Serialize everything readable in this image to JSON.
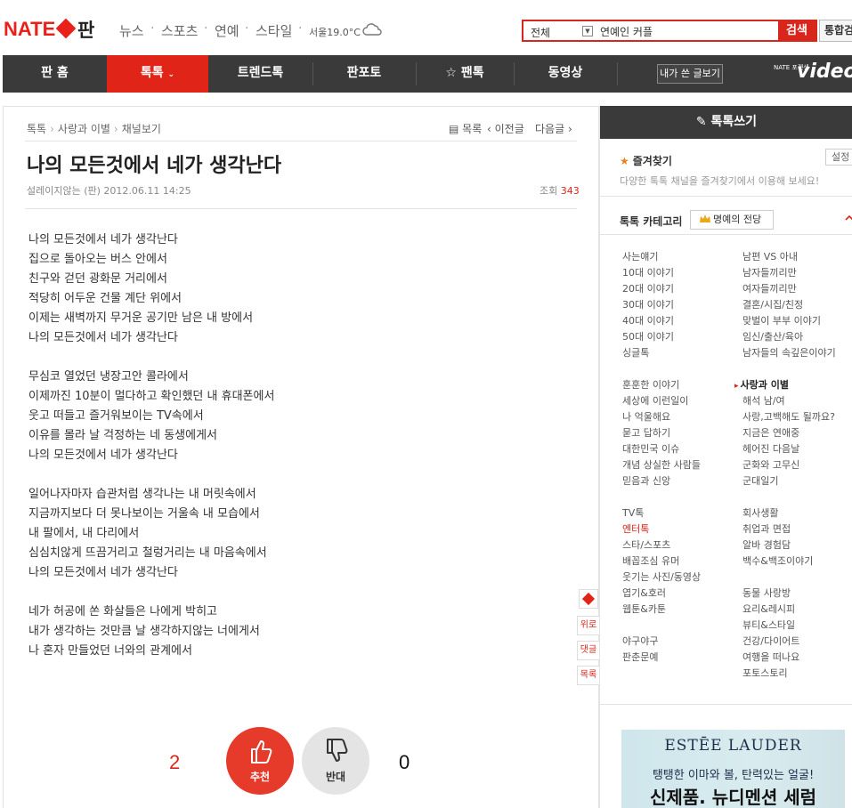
{
  "header": {
    "logo_text": "NATE",
    "logo_pan": "판",
    "links": [
      "뉴스",
      "스포츠",
      "연예",
      "스타일"
    ],
    "weather": "서울19.0°C",
    "search": {
      "scope": "전체",
      "value": "연예인 커플",
      "button": "검색",
      "total_button": "통합검색"
    }
  },
  "nav": {
    "items": [
      "판 홈",
      "톡톡",
      "트렌드톡",
      "판포토",
      "팬톡",
      "동영상"
    ],
    "active_index": 1,
    "my_posts": "내가 쓴 글보기",
    "video_small": "NATE 포켓생",
    "video_big": "video"
  },
  "article": {
    "breadcrumb": [
      "톡톡",
      "사랑과 이별",
      "채널보기"
    ],
    "post_nav": {
      "list": "목록",
      "prev": "이전글",
      "next": "다음글"
    },
    "title": "나의 모든것에서 네가 생각난다",
    "meta": "설레이지않는 (판) 2012.06.11 14:25",
    "views_label": "조회",
    "views": "343",
    "body": [
      "나의 모든것에서 네가 생각난다",
      "집으로 돌아오는 버스 안에서",
      "친구와 걷던 광화문 거리에서",
      "적당히 어두운 건물 계단 위에서",
      "이제는 새벽까지 무거운 공기만 남은 내 방에서",
      "나의 모든것에서 네가 생각난다",
      "",
      "무심코 열었던 냉장고안 콜라에서",
      "이제까진 10분이 멀다하고 확인했던 내 휴대폰에서",
      "웃고 떠들고 즐거워보이는 TV속에서",
      "이유를 몰라 날 걱정하는 네 동생에게서",
      "나의 모든것에서 네가 생각난다",
      "",
      "일어나자마자 습관처럼 생각나는 내 머릿속에서",
      "지금까지보다 더 못나보이는 거울속 내 모습에서",
      "내 팔에서, 내 다리에서",
      "심심치않게 뜨끔거리고 철렁거리는 내 마음속에서",
      "나의 모든것에서 네가 생각난다",
      "",
      "네가 허공에 쏜 화살들은 나에게 박히고",
      "내가 생각하는 것만큼 날 생각하지않는 너에게서",
      "나 혼자 만들었던 너와의 관계에서"
    ],
    "vote": {
      "up_count": "2",
      "up_label": "추천",
      "down_label": "반대",
      "down_count": "0"
    },
    "float_tools": [
      "위로",
      "댓글",
      "목록"
    ]
  },
  "sidebar": {
    "write": "톡톡쓰기",
    "favorites_title": "즐겨찾기",
    "favorites_desc": "다양한 톡톡 채널을 즐겨찾기에서 이용해 보세요!",
    "settings": "설정",
    "category_title": "톡톡 카테고리",
    "hall_of_fame": "명예의 전당",
    "left_col": {
      "group1": [
        "사는얘기",
        "10대 이야기",
        "20대 이야기",
        "30대 이야기",
        "40대 이야기",
        "50대 이야기",
        "싱글톡"
      ],
      "group2": [
        "훈훈한 이야기",
        "세상에 이런일이",
        "나 억울해요",
        "묻고 답하기",
        "대한민국 이슈",
        "개념 상실한 사람들",
        "믿음과 신앙"
      ],
      "group3": [
        "TV톡",
        "엔터톡",
        "스타/스포츠",
        "배꼽조심 유머",
        "웃기는 사진/동영상",
        "엽기&호러",
        "웹툰&카툰",
        "",
        "야구야구",
        "판춘문예"
      ]
    },
    "right_col": {
      "group1": [
        "남편 VS 아내",
        "남자들끼리만",
        "여자들끼리만",
        "결혼/시집/친정",
        "맞벌이 부부 이야기",
        "임신/출산/육아",
        "남자들의 속깊은이야기"
      ],
      "group2": [
        "사랑과 이별",
        "해석 남/여",
        "사랑,고백해도 될까요?",
        "지금은 연애중",
        "헤어진 다음날",
        "군화와 고무신",
        "군대일기"
      ],
      "group3": [
        "회사생활",
        "취업과 면접",
        "알바 경험담",
        "백수&백조이야기",
        "",
        "동물 사랑방",
        "요리&레시피",
        "뷰티&스타일",
        "건강/다이어트",
        "여행을 떠나요",
        "포토스토리"
      ]
    },
    "active_category": "엔터톡",
    "current_category": "사랑과 이별",
    "ad": {
      "brand": "ESTĒE LAUDER",
      "line1": "탱탱한 이마와 볼, 탄력있는 얼굴!",
      "line2": "신제품. 뉴디멘션 세럼"
    }
  },
  "colors": {
    "brand_red": "#e02418",
    "nav_dark": "#3a3a3a",
    "views_red": "#d9261c"
  }
}
